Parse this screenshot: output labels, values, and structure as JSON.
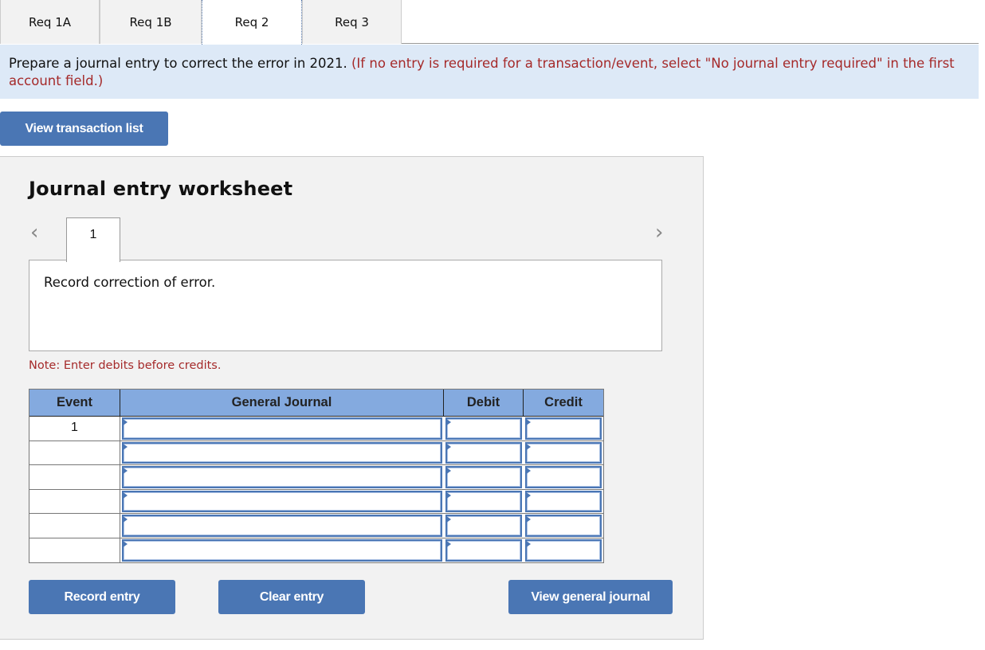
{
  "tabs": [
    {
      "label": "Req 1A",
      "active": false
    },
    {
      "label": "Req 1B",
      "active": false
    },
    {
      "label": "Req 2",
      "active": true
    },
    {
      "label": "Req 3",
      "active": false
    }
  ],
  "instruction": {
    "main": "Prepare a journal entry to correct the error in 2021. ",
    "hint": "(If no entry is required for a transaction/event, select \"No journal entry required\" in the first account field.)"
  },
  "buttons": {
    "view_transaction_list": "View transaction list",
    "record_entry": "Record entry",
    "clear_entry": "Clear entry",
    "view_general_journal": "View general journal"
  },
  "worksheet": {
    "title": "Journal entry worksheet",
    "prev_icon": "‹",
    "next_icon": "›",
    "entry_tab": "1",
    "description": "Record correction of error.",
    "note": "Note: Enter debits before credits."
  },
  "journal": {
    "headers": {
      "event": "Event",
      "general_journal": "General Journal",
      "debit": "Debit",
      "credit": "Credit"
    },
    "rows": [
      {
        "event": "1",
        "account": "",
        "debit": "",
        "credit": ""
      },
      {
        "event": "",
        "account": "",
        "debit": "",
        "credit": ""
      },
      {
        "event": "",
        "account": "",
        "debit": "",
        "credit": ""
      },
      {
        "event": "",
        "account": "",
        "debit": "",
        "credit": ""
      },
      {
        "event": "",
        "account": "",
        "debit": "",
        "credit": ""
      },
      {
        "event": "",
        "account": "",
        "debit": "",
        "credit": ""
      }
    ]
  },
  "colors": {
    "accent_button": "#4a76b4",
    "header_blue": "#84aadf",
    "instruction_bg": "#dde9f7",
    "hint_red": "#a52a2a"
  }
}
